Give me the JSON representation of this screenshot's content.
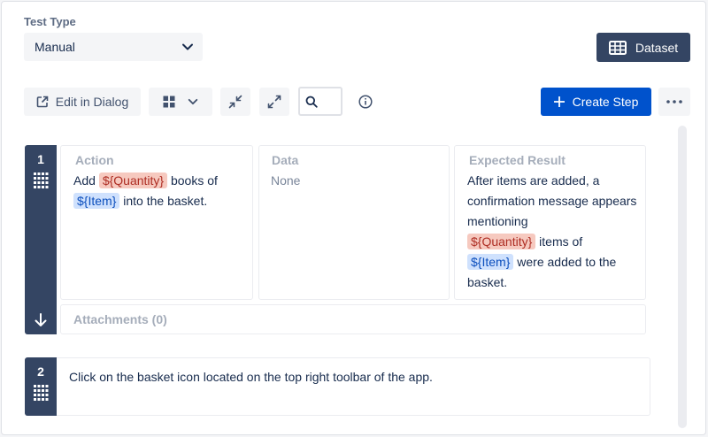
{
  "test_type": {
    "label": "Test Type",
    "selected": "Manual"
  },
  "dataset_button": "Dataset",
  "toolbar": {
    "edit_in_dialog": "Edit in Dialog",
    "create_step": "Create Step"
  },
  "steps": [
    {
      "number": "1",
      "action_header": "Action",
      "action": {
        "t1": "Add",
        "param1": "${Quantity}",
        "t2": "books of",
        "param2": "${Item}",
        "t3": "into the basket."
      },
      "data_header": "Data",
      "data_value": "None",
      "expected_header": "Expected Result",
      "expected": {
        "t1": "After items are added, a confirmation message appears mentioning",
        "param1": "${Quantity}",
        "t2": "items of",
        "param2": "${Item}",
        "t3": "were added to the basket."
      },
      "attachments_label": "Attachments (0)"
    },
    {
      "number": "2",
      "text": "Click on the basket icon located on the top right toolbar of the app."
    }
  ],
  "icons": {
    "select_arrow": "chevron-down-icon",
    "dataset": "table-icon",
    "edit_in_dialog": "external-link-icon",
    "layout": "grid-layout-icon",
    "collapse": "collapse-icon",
    "expand": "expand-icon",
    "search": "search-icon",
    "info": "info-icon",
    "create": "plus-icon",
    "more": "more-icon",
    "drag": "drag-handle-icon",
    "move_down": "arrow-down-icon"
  },
  "colors": {
    "primary": "#0052cc",
    "dark": "#344563",
    "param_red_bg": "#f6c9bf",
    "param_blue_bg": "#cfe1fd"
  }
}
